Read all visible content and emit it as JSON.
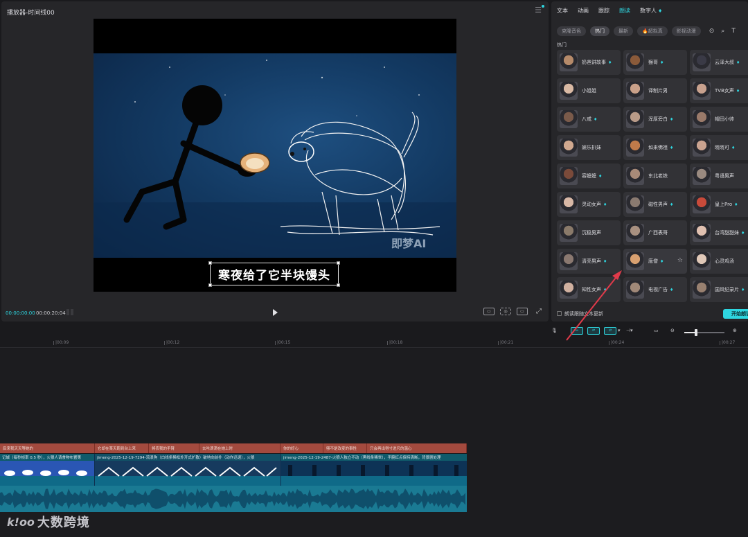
{
  "player": {
    "title": "播放器-时间线00",
    "time_current": "00:00:00:00",
    "time_total": "00:00:20:04",
    "subtitle": "寒夜给了它半块馒头",
    "video_watermark": "即梦AI"
  },
  "panel": {
    "tabs": [
      {
        "label": "文本"
      },
      {
        "label": "动画"
      },
      {
        "label": "跟踪"
      },
      {
        "label": "朗读"
      },
      {
        "label": "数字人"
      }
    ],
    "chips": [
      {
        "label": "克隆音色"
      },
      {
        "label": "热门"
      },
      {
        "label": "最新"
      },
      {
        "label": "🔥超拟真"
      },
      {
        "label": "影视动漫"
      }
    ],
    "section_label": "热门",
    "voices": [
      {
        "name": "奶爸讲故事",
        "vip": true
      },
      {
        "name": "猴哥",
        "vip": true
      },
      {
        "name": "云泽大叔",
        "vip": true
      },
      {
        "name": "小姐姐",
        "vip": false
      },
      {
        "name": "译制片男",
        "vip": false
      },
      {
        "name": "TVB女声",
        "vip": true
      },
      {
        "name": "八戒",
        "vip": true
      },
      {
        "name": "浑厚旁白",
        "vip": true
      },
      {
        "name": "帽田小帅",
        "vip": false
      },
      {
        "name": "娱乐扒妹",
        "vip": false
      },
      {
        "name": "如来佛祖",
        "vip": true
      },
      {
        "name": "晓晓可",
        "vip": true
      },
      {
        "name": "容嬷嬷",
        "vip": true
      },
      {
        "name": "东北老铁",
        "vip": false
      },
      {
        "name": "粤语男声",
        "vip": false
      },
      {
        "name": "灵动女声",
        "vip": true
      },
      {
        "name": "磁性男声",
        "vip": true
      },
      {
        "name": "皇上Pro",
        "vip": true
      },
      {
        "name": "沉稳男声",
        "vip": false
      },
      {
        "name": "广西表哥",
        "vip": false
      },
      {
        "name": "台湾甜甜妹",
        "vip": true
      },
      {
        "name": "清亮男声",
        "vip": true
      },
      {
        "name": "唐僧",
        "vip": true,
        "selected": true
      },
      {
        "name": "心灵鸡汤",
        "vip": false
      },
      {
        "name": "知性女声",
        "vip": true
      },
      {
        "name": "电视广告",
        "vip": true
      },
      {
        "name": "国风纪录片",
        "vip": true
      }
    ],
    "checkbox_label": "朗读跟随文本更新",
    "start_button": "开始朗读"
  },
  "timeline": {
    "ruler": [
      "|00:09",
      "|00:12",
      "|00:15",
      "|00:18",
      "|00:21",
      "|00:24",
      "|00:27"
    ],
    "text_clips": [
      {
        "label": "后来我天天等她的"
      },
      {
        "label": "它却在某天跑到台上来"
      },
      {
        "label": "将农我的手臂"
      },
      {
        "label": "去咔滴滴在她上时"
      },
      {
        "label": "你的好心"
      },
      {
        "label": "够不是改变的事性"
      },
      {
        "label": "只会再出得寸进尺的温心"
      }
    ],
    "video_clips": [
      {
        "label": "记城（每秒帧率 0.5 秒），火狼人请食物布置第"
      },
      {
        "label": "jimeng-2025-12-19-7294-流浪狗（白线条稀松外开式扩散）破地向前扑（动作迅速），火狼"
      },
      {
        "label": "jimeng-2025-12-19-2487-火狼人独立不动（黑线条稀世），手腕红点保持清晰，背景剧处理"
      }
    ]
  },
  "watermark": {
    "text": "大数跨境",
    "logo": "k!oo"
  },
  "colors": {
    "accent": "#2ed6e0",
    "text_clip": "#a34a3e",
    "audio": "#1a7a93",
    "arrow": "#e03a4a"
  }
}
